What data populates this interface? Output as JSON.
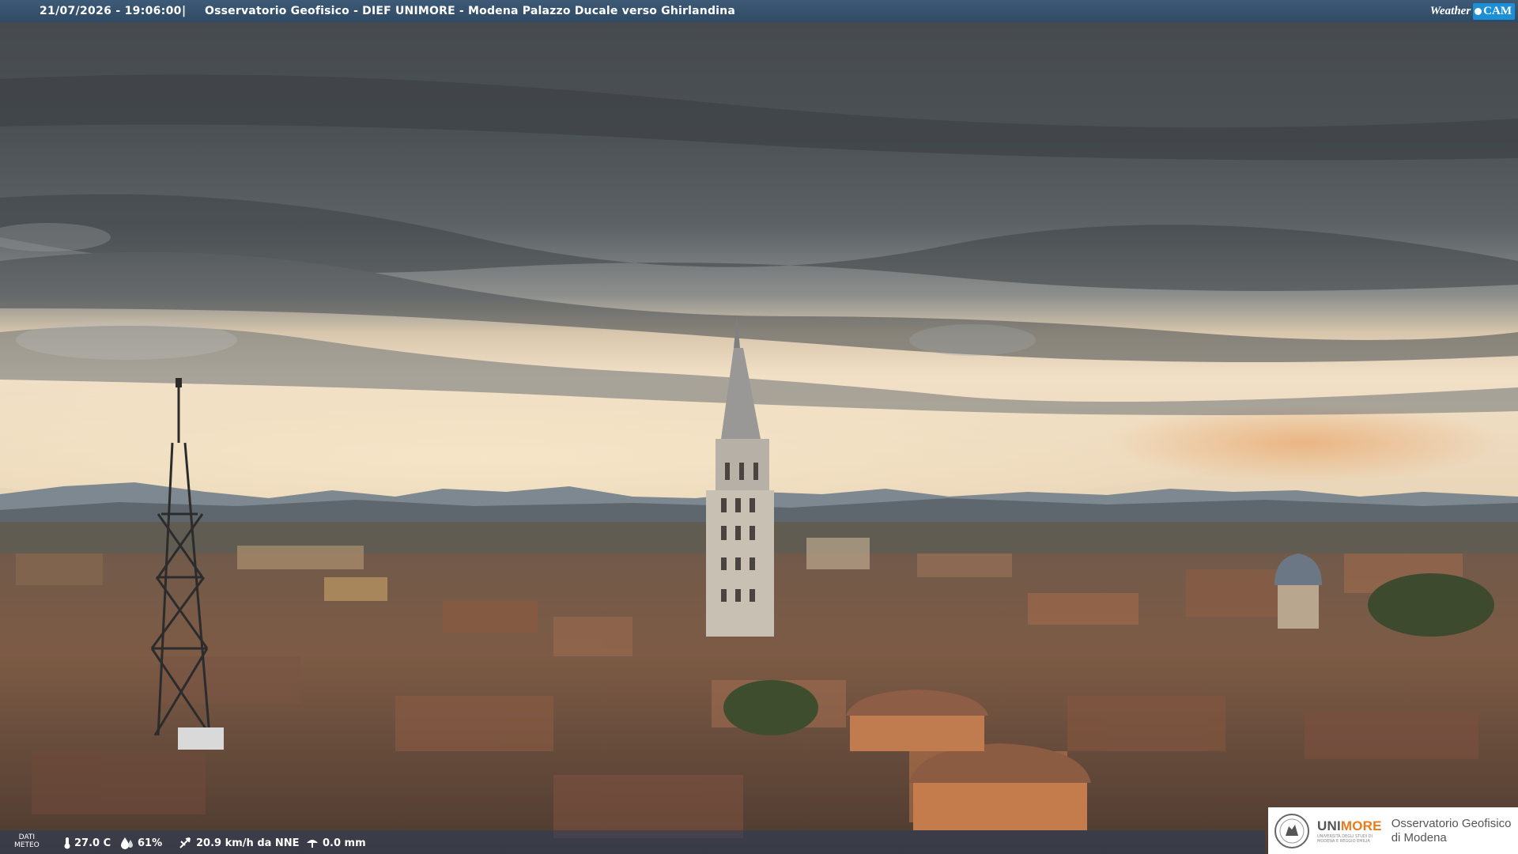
{
  "overlay": {
    "timestamp": "21/07/2026 - 19:06:00",
    "separator": "|",
    "camera_name": "Osservatorio Geofisico - DIEF UNIMORE - Modena Palazzo Ducale verso Ghirlandina",
    "brand": {
      "weather": "Weather",
      "cam": "CAM",
      "cam_color": "#1d8fd6"
    }
  },
  "weather_bar": {
    "label_line1": "DATI",
    "label_line2": "METEO",
    "temperature": "27.0 C",
    "humidity": "61%",
    "wind": "20.9 km/h da NNE",
    "rain": "0.0 mm"
  },
  "logo": {
    "university_a": "UNI",
    "university_b": "MORE",
    "university_sub_1": "UNIVERSITÀ DEGLI STUDI DI",
    "university_sub_2": "MODENA E REGGIO EMILIA",
    "observatory_line1": "Osservatorio Geofisico",
    "observatory_line2": "di Modena"
  }
}
